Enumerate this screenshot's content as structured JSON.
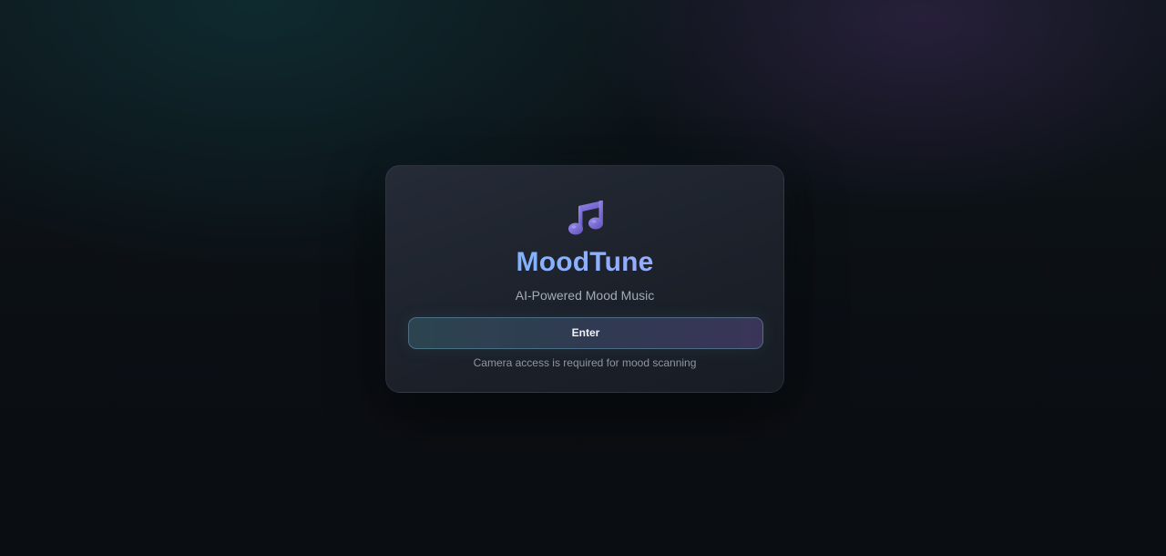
{
  "app": {
    "logo_icon": "music-note-icon",
    "title": "MoodTune",
    "subtitle": "AI-Powered Mood Music"
  },
  "enter_button": {
    "label": "Enter"
  },
  "note": "Camera access is required for mood scanning",
  "colors": {
    "title_gradient_start": "#6fb6ff",
    "title_gradient_end": "#a9a3ff",
    "icon": "#7c6fd6",
    "background": "#0b0f14"
  }
}
